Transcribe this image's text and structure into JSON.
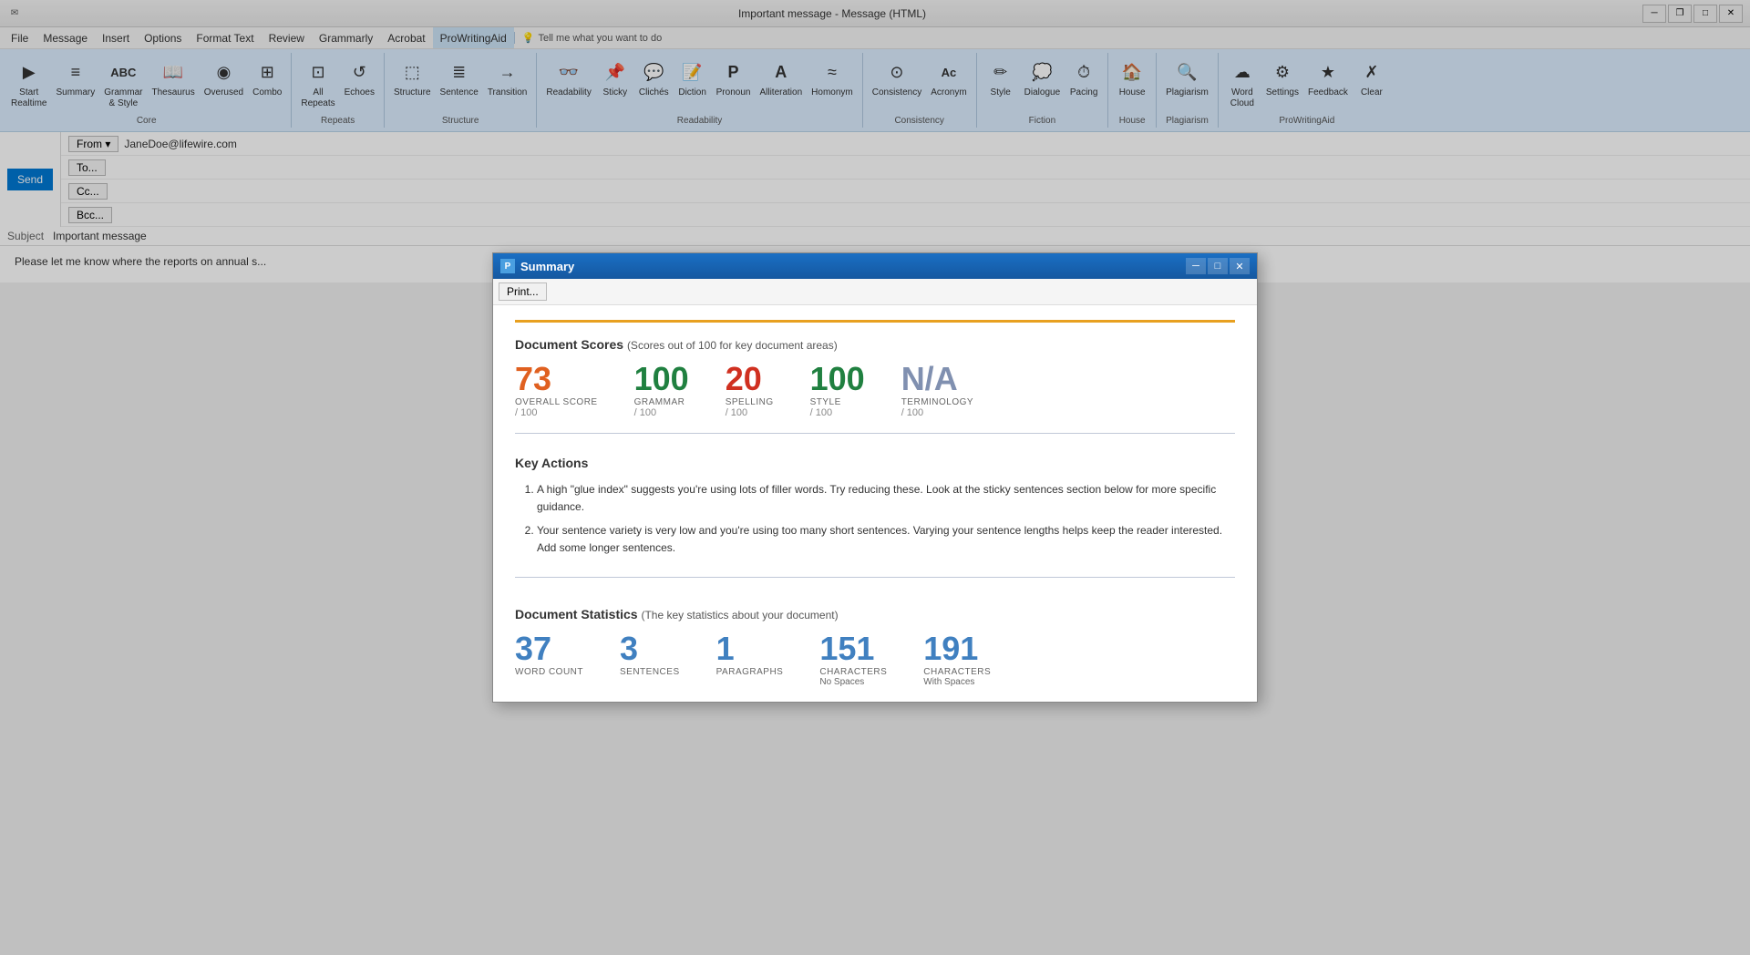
{
  "titlebar": {
    "title": "Important message - Message (HTML)",
    "min_btn": "─",
    "restore_btn": "❐",
    "max_btn": "□",
    "close_btn": "✕"
  },
  "menubar": {
    "items": [
      "File",
      "Message",
      "Insert",
      "Options",
      "Format Text",
      "Review",
      "Grammarly",
      "Acrobat",
      "ProWritingAid",
      "Tell me what you want to do"
    ]
  },
  "ribbon": {
    "groups": [
      {
        "label": "Core",
        "items": [
          {
            "id": "start-realtime",
            "icon": "▶",
            "label": "Start\nRealtime"
          },
          {
            "id": "summary",
            "icon": "≡",
            "label": "Summary"
          },
          {
            "id": "grammar-style",
            "icon": "ABC",
            "label": "Grammar\n& Style"
          },
          {
            "id": "thesaurus",
            "icon": "📖",
            "label": "Thesaurus"
          },
          {
            "id": "overused",
            "icon": "◉",
            "label": "Overused"
          },
          {
            "id": "combo",
            "icon": "⊞",
            "label": "Combo"
          }
        ]
      },
      {
        "label": "Repeats",
        "items": [
          {
            "id": "all",
            "icon": "⊡",
            "label": "All\nRepeats"
          },
          {
            "id": "echoes",
            "icon": "↺",
            "label": "Echoes"
          }
        ]
      },
      {
        "label": "Structure",
        "items": [
          {
            "id": "structure",
            "icon": "⬚",
            "label": "Structure"
          },
          {
            "id": "sentence",
            "icon": "≣",
            "label": "Sentence"
          },
          {
            "id": "transition",
            "icon": "→",
            "label": "Transition"
          }
        ]
      },
      {
        "label": "Readability",
        "items": [
          {
            "id": "readability",
            "icon": "👓",
            "label": "Readability"
          },
          {
            "id": "sticky",
            "icon": "📌",
            "label": "Sticky"
          },
          {
            "id": "cliches",
            "icon": "💬",
            "label": "Clichés"
          },
          {
            "id": "diction",
            "icon": "📝",
            "label": "Diction"
          },
          {
            "id": "pronoun",
            "icon": "P",
            "label": "Pronoun"
          },
          {
            "id": "alliteration",
            "icon": "A",
            "label": "Alliteration"
          },
          {
            "id": "homonym",
            "icon": "≈",
            "label": "Homonym"
          }
        ]
      },
      {
        "label": "Consistency",
        "items": [
          {
            "id": "consistency",
            "icon": "⊙",
            "label": "Consistency"
          },
          {
            "id": "acronym",
            "icon": "Ac",
            "label": "Acronym"
          }
        ]
      },
      {
        "label": "Fiction",
        "items": [
          {
            "id": "style",
            "icon": "✏",
            "label": "Style"
          },
          {
            "id": "dialogue",
            "icon": "💭",
            "label": "Dialogue"
          },
          {
            "id": "pacing",
            "icon": "⏱",
            "label": "Pacing"
          }
        ]
      },
      {
        "label": "House",
        "items": [
          {
            "id": "house",
            "icon": "🏠",
            "label": "House"
          }
        ]
      },
      {
        "label": "Plagiarism",
        "items": [
          {
            "id": "plagiarism",
            "icon": "🔍",
            "label": "Plagiarism"
          }
        ]
      },
      {
        "label": "ProWritingAid",
        "items": [
          {
            "id": "word-cloud",
            "icon": "☁",
            "label": "Word\nCloud"
          },
          {
            "id": "settings",
            "icon": "⚙",
            "label": "Settings"
          },
          {
            "id": "feedback",
            "icon": "★",
            "label": "Feedback"
          },
          {
            "id": "clear",
            "icon": "✗",
            "label": "Clear"
          }
        ]
      }
    ]
  },
  "email": {
    "from_label": "From ▾",
    "from_value": "JaneDoe@lifewire.com",
    "to_label": "To...",
    "cc_label": "Cc...",
    "bcc_label": "Bcc...",
    "subject_label": "Subject",
    "subject_value": "Important message",
    "send_label": "Send",
    "body_text": "Please let me know where the reports on annual s..."
  },
  "modal": {
    "title": "Summary",
    "title_icon": "P",
    "min_btn": "─",
    "restore_btn": "□",
    "close_btn": "✕",
    "print_btn": "Print...",
    "document_scores": {
      "heading": "Document Scores",
      "subheading": "(Scores out of 100 for key document areas)",
      "scores": [
        {
          "value": "73",
          "color_class": "orange",
          "label": "OVERALL SCORE",
          "max": "/ 100"
        },
        {
          "value": "100",
          "color_class": "green",
          "label": "GRAMMAR",
          "max": "/ 100"
        },
        {
          "value": "20",
          "color_class": "red",
          "label": "SPELLING",
          "max": "/ 100"
        },
        {
          "value": "100",
          "color_class": "green",
          "label": "STYLE",
          "max": "/ 100"
        },
        {
          "value": "N/A",
          "color_class": "gray",
          "label": "TERMINOLOGY",
          "max": "/ 100"
        }
      ]
    },
    "key_actions": {
      "heading": "Key Actions",
      "items": [
        "A high \"glue index\" suggests you're using lots of filler words. Try reducing these. Look at the sticky sentences section below for more specific guidance.",
        "Your sentence variety is very low and you're using too many short sentences. Varying your sentence lengths helps keep the reader interested. Add some longer sentences."
      ]
    },
    "document_statistics": {
      "heading": "Document Statistics",
      "subheading": "(The key statistics about your document)",
      "stats": [
        {
          "value": "37",
          "label": "WORD COUNT",
          "sublabel": ""
        },
        {
          "value": "3",
          "label": "SENTENCES",
          "sublabel": ""
        },
        {
          "value": "1",
          "label": "PARAGRAPHS",
          "sublabel": ""
        },
        {
          "value": "151",
          "label": "CHARACTERS",
          "sublabel": "No Spaces"
        },
        {
          "value": "191",
          "label": "CHARACTERS",
          "sublabel": "With Spaces"
        }
      ]
    }
  }
}
